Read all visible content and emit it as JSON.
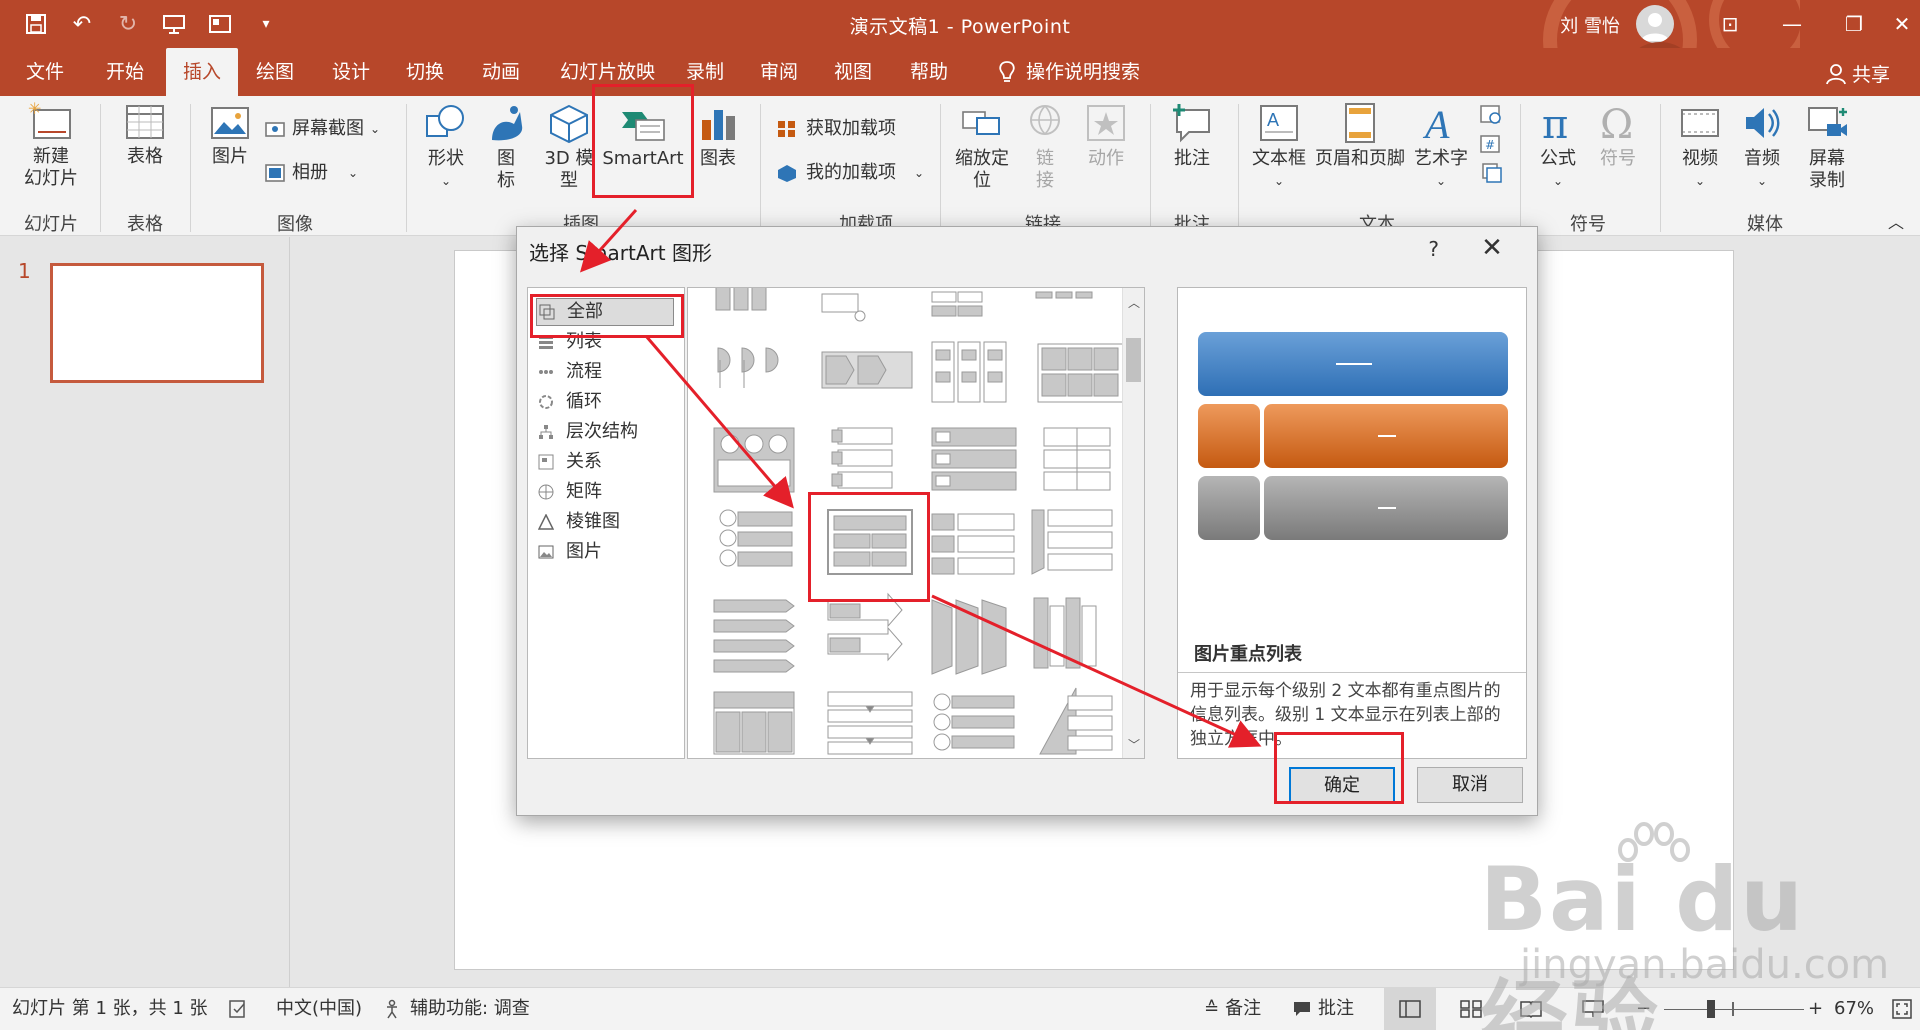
{
  "window": {
    "title": "演示文稿1 - PowerPoint",
    "user": "刘 雪怡",
    "share": "共享"
  },
  "tabs": [
    "文件",
    "开始",
    "插入",
    "绘图",
    "设计",
    "切换",
    "动画",
    "幻灯片放映",
    "录制",
    "审阅",
    "视图",
    "帮助"
  ],
  "tell_me": "操作说明搜索",
  "ribbon": {
    "new_slide_1": "新建",
    "new_slide_2": "幻灯片",
    "table": "表格",
    "picture": "图片",
    "screenshot": "屏幕截图",
    "album": "相册",
    "shapes": "形状",
    "icons_1": "图",
    "icons_2": "标",
    "model3d_1": "3D 模",
    "model3d_2": "型",
    "smartart": "SmartArt",
    "chart": "图表",
    "get_addins": "获取加载项",
    "my_addins": "我的加载项",
    "zoom_1": "缩放定",
    "zoom_2": "位",
    "link_1": "链",
    "link_2": "接",
    "action": "动作",
    "comment": "批注",
    "textbox": "文本框",
    "header_footer": "页眉和页脚",
    "wordart": "艺术字",
    "equation": "公式",
    "symbol": "符号",
    "video": "视频",
    "audio": "音频",
    "screen_rec_1": "屏幕",
    "screen_rec_2": "录制",
    "groups": {
      "slides": "幻灯片",
      "tables": "表格",
      "images": "图像",
      "illustrations": "插图",
      "addins": "加载项",
      "links": "链接",
      "comments": "批注",
      "text": "文本",
      "symbols": "符号",
      "media": "媒体"
    }
  },
  "slide_pane": {
    "number": "1"
  },
  "dialog": {
    "title": "选择 SmartArt 图形",
    "help": "?",
    "categories": [
      "全部",
      "列表",
      "流程",
      "循环",
      "层次结构",
      "关系",
      "矩阵",
      "棱锥图",
      "图片"
    ],
    "selected_name": "图片重点列表",
    "selected_desc": "用于显示每个级别 2 文本都有重点图片的信息列表。级别 1 文本显示在列表上部的独立方框中。",
    "ok": "确定",
    "cancel": "取消"
  },
  "status": {
    "slide_info": "幻灯片 第 1 张，共 1 张",
    "language": "中文(中国)",
    "accessibility": "辅助功能: 调查",
    "notes": "备注",
    "comments": "批注",
    "zoom": "67%"
  },
  "watermark": {
    "main": "Bai du 经验",
    "sub": "jingyan.baidu.com"
  },
  "colors": {
    "accent": "#b7472a",
    "annotation": "#e4202a",
    "blue": "#2e75b6",
    "orange": "#c55a11",
    "gray": "#8c8c8c"
  }
}
